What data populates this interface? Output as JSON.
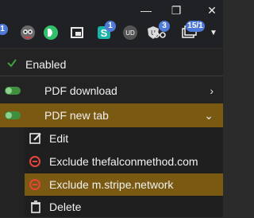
{
  "toolbar": {
    "extensions": [
      {
        "name": "ext-badge-left",
        "badge": "1"
      },
      {
        "name": "owl-extension-icon"
      },
      {
        "name": "green-d-extension-icon"
      },
      {
        "name": "window-extension-icon"
      },
      {
        "name": "s-extension-icon",
        "badge": "1"
      },
      {
        "name": "ud-extension-icon"
      },
      {
        "name": "shield-u-extension-icon"
      },
      {
        "name": "reader-extension-icon",
        "badge": "3"
      },
      {
        "name": "tabs-extension-icon",
        "badge": "15/1"
      }
    ]
  },
  "menu": {
    "enabled_label": "Enabled",
    "items": [
      {
        "label": "PDF download"
      },
      {
        "label": "PDF new tab"
      }
    ],
    "submenu": [
      {
        "label": "Edit"
      },
      {
        "label": "Exclude thefalconmethod.com"
      },
      {
        "label": "Exclude m.stripe.network"
      },
      {
        "label": "Delete"
      }
    ]
  },
  "colors": {
    "highlight": "#7a5a12",
    "toggle_on": "#3f8f3f",
    "danger": "#e8453c",
    "badge": "#4f7ad8"
  }
}
